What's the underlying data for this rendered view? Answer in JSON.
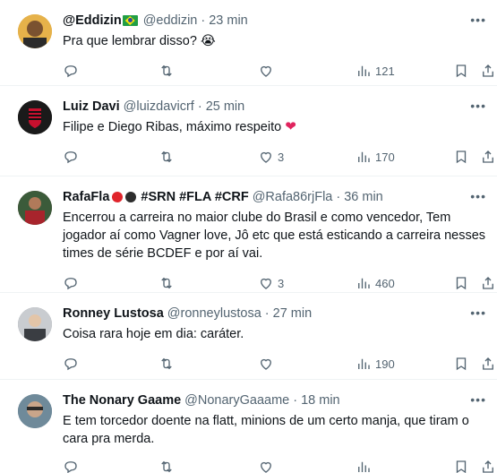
{
  "tweets": [
    {
      "name": "@Eddizin",
      "handle": "@eddizin",
      "time": "23 min",
      "text": "Pra que lembrar disso? 😭",
      "replies": "",
      "retweets": "",
      "likes": "",
      "views": "121",
      "avatar_color": "#d9a23a"
    },
    {
      "name": "Luiz Davi",
      "handle": "@luizdavicrf",
      "time": "25 min",
      "text": "Filipe e Diego Ribas, máximo respeito",
      "replies": "",
      "retweets": "",
      "likes": "3",
      "views": "170",
      "avatar_color": "#1a1a1a"
    },
    {
      "name": "RafaFla",
      "name_tags": "#SRN #FLA #CRF",
      "handle": "@Rafa86rjFla",
      "time": "36 min",
      "text": "Encerrou a carreira no maior clube do Brasil e como vencedor, Tem jogador aí como Vagner love, Jô etc que está esticando a carreira nesses times de série BCDEF e por aí vai.",
      "replies": "",
      "retweets": "",
      "likes": "3",
      "views": "460",
      "avatar_color": "#5a2a2a"
    },
    {
      "name": "Ronney Lustosa",
      "handle": "@ronneylustosa",
      "time": "27 min",
      "text": "Coisa rara hoje em dia: caráter.",
      "replies": "",
      "retweets": "",
      "likes": "",
      "views": "190",
      "avatar_color": "#8a8f96"
    },
    {
      "name": "The Nonary Gaame",
      "handle": "@NonaryGaaame",
      "time": "18 min",
      "text": "E tem torcedor doente na flatt, minions de um certo manja, que tiram o cara pra merda.",
      "replies": "",
      "retweets": "",
      "likes": "",
      "views": "",
      "avatar_color": "#4a6b82"
    }
  ],
  "colors": {
    "secondary": "#536471",
    "primary": "#0f1419",
    "heart": "#e0245e",
    "divider": "#eff3f4"
  },
  "icons": [
    "reply-icon",
    "retweet-icon",
    "like-icon",
    "views-icon",
    "bookmark-icon",
    "share-icon",
    "more-icon"
  ]
}
